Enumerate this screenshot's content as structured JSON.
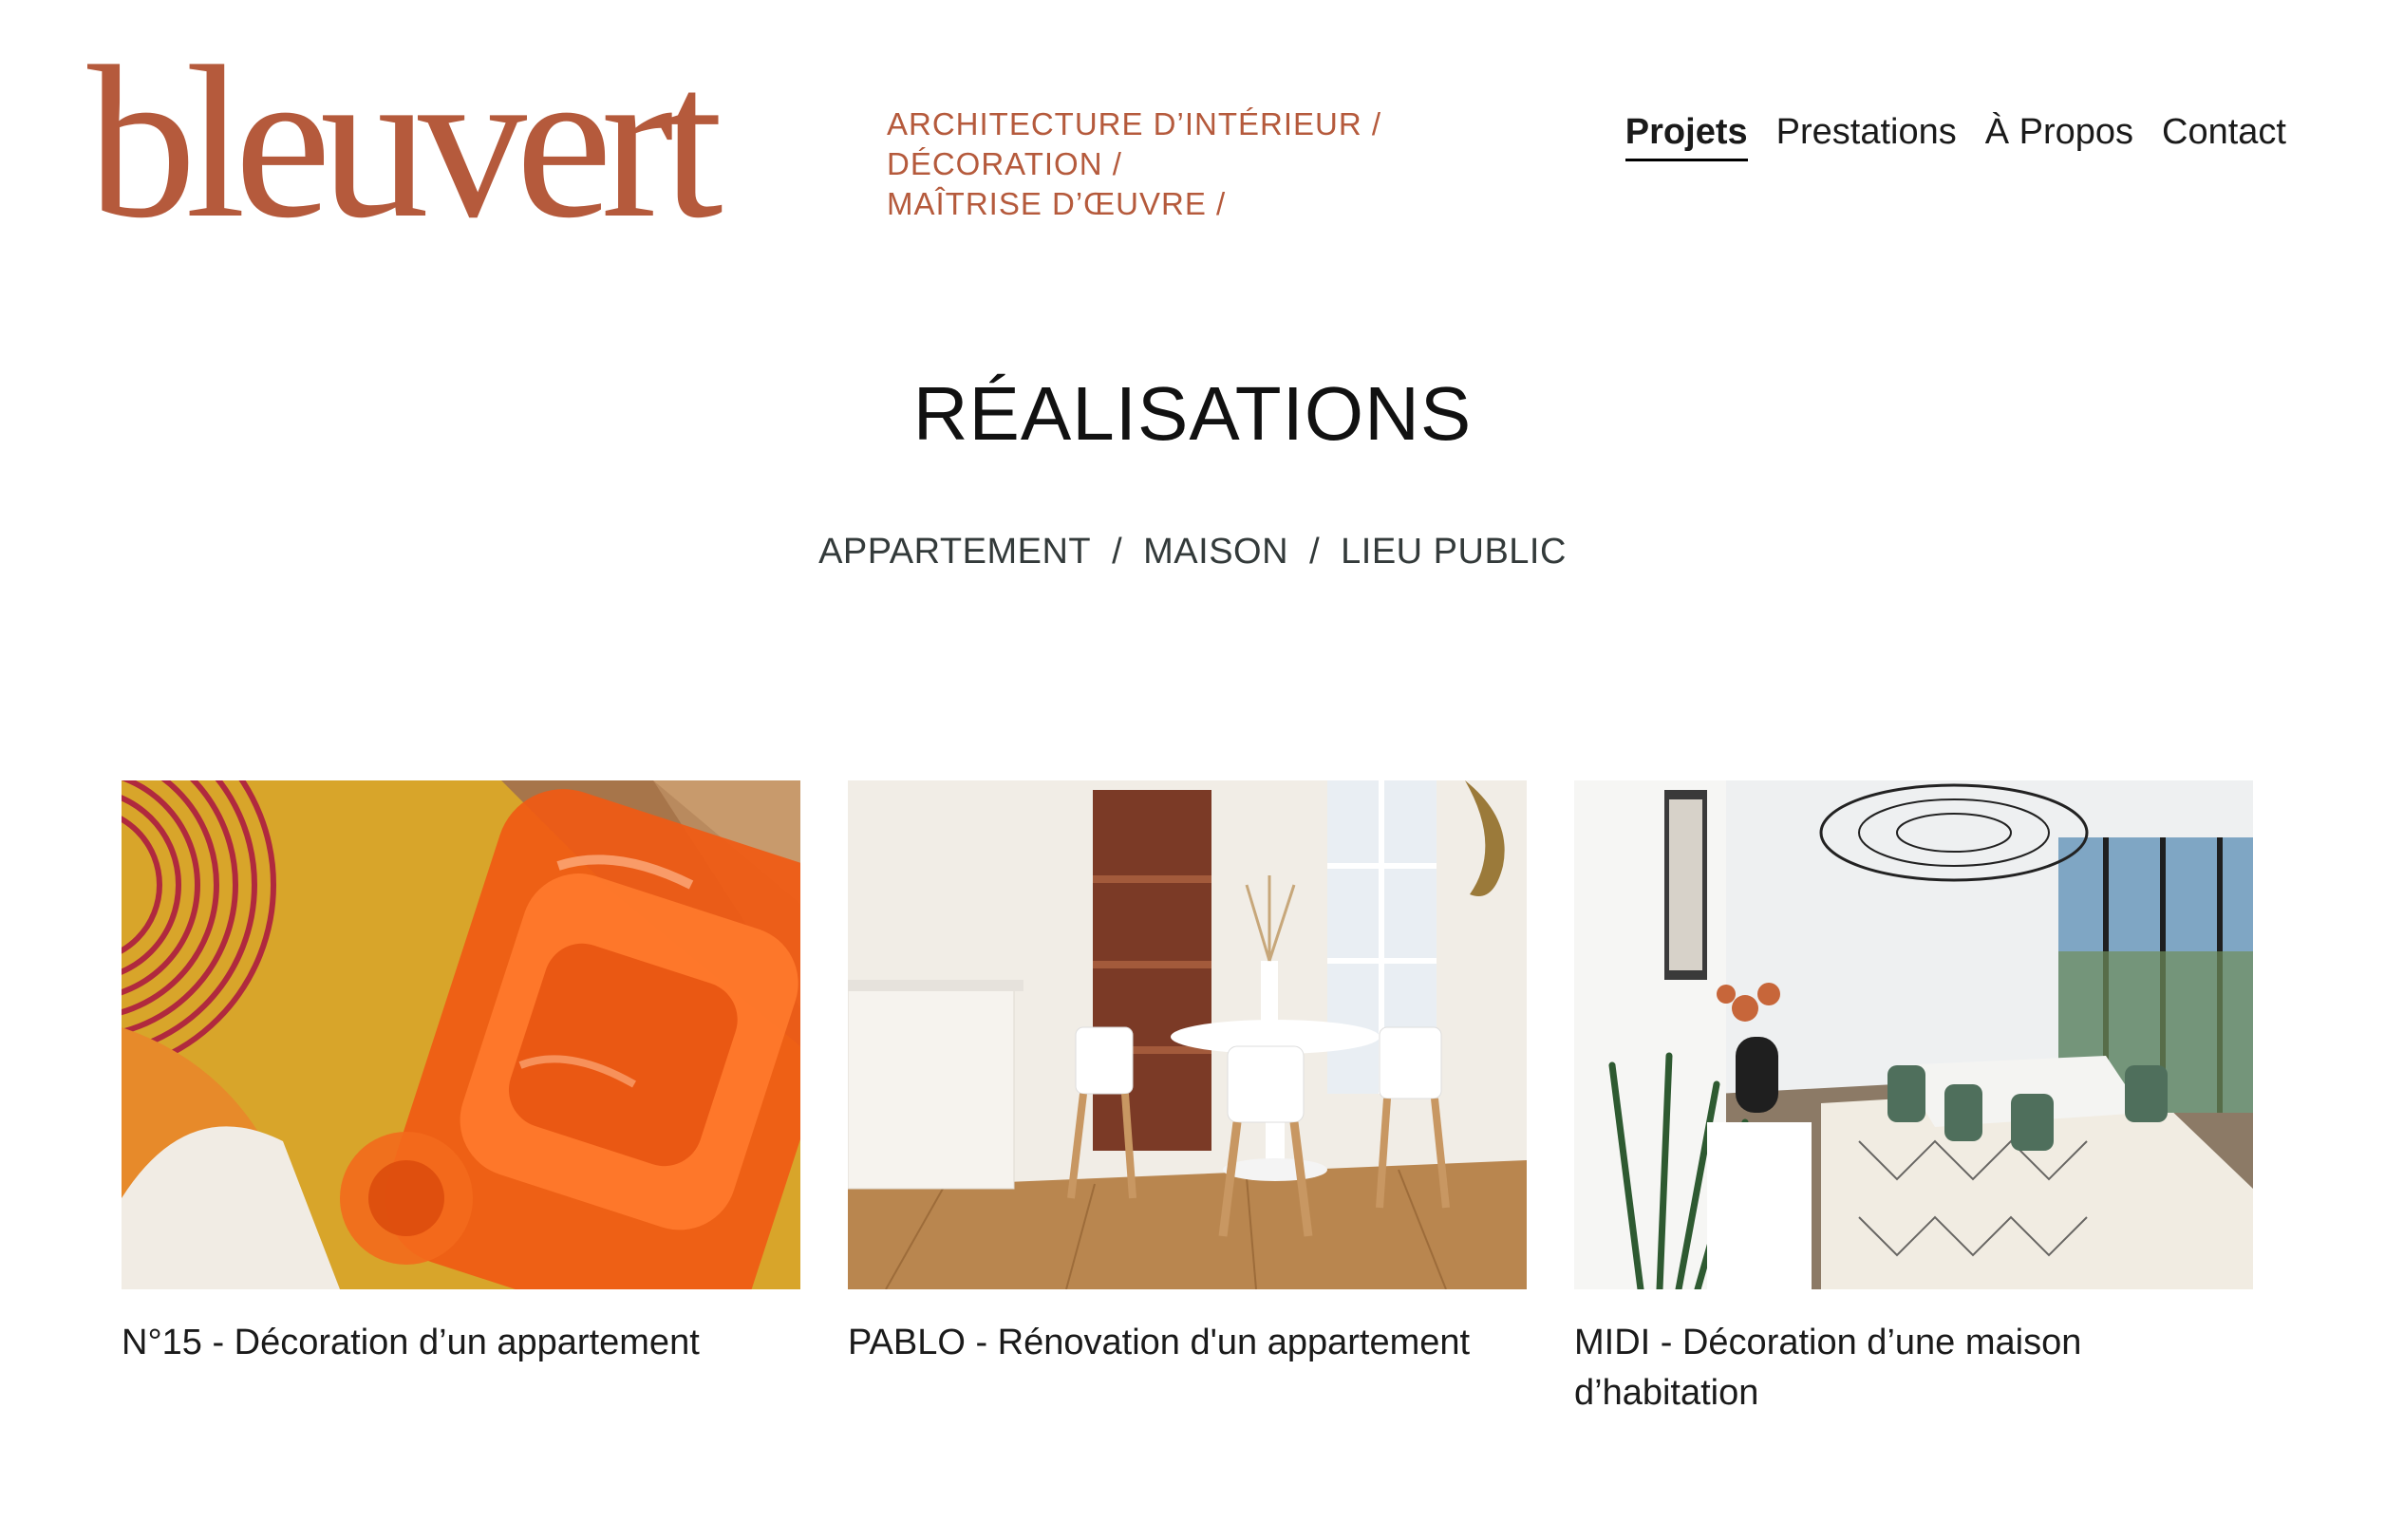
{
  "header": {
    "logo_text": "bleuvert",
    "tagline": [
      "ARCHITECTURE D’INTÉRIEUR /",
      "DÉCORATION /",
      "MAÎTRISE D’ŒUVRE /"
    ],
    "brand_color": "#b55a3c"
  },
  "nav": {
    "items": [
      {
        "label": "Projets",
        "active": true
      },
      {
        "label": "Prestations",
        "active": false
      },
      {
        "label": "À Propos",
        "active": false
      },
      {
        "label": "Contact",
        "active": false
      }
    ]
  },
  "main": {
    "title": "RÉALISATIONS",
    "filters": [
      {
        "label": "APPARTEMENT"
      },
      {
        "label": "MAISON"
      },
      {
        "label": "LIEU PUBLIC"
      }
    ],
    "filter_separator": "/",
    "projects": [
      {
        "caption": "N°15 - Décoration d’un appartement",
        "image": "orange-inflatable-chair-on-yellow-rug"
      },
      {
        "caption": "PABLO - Rénovation d'un appartement",
        "image": "white-dining-table-with-wooden-chairs"
      },
      {
        "caption": "MIDI - Décoration d’une maison d’habitation",
        "image": "dining-room-with-green-chairs-and-pendant-lamp"
      }
    ]
  }
}
